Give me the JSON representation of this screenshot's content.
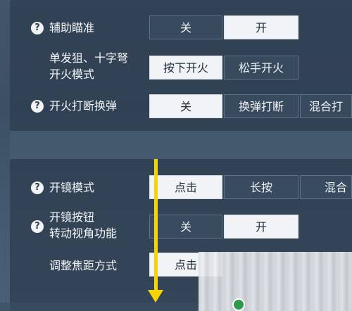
{
  "settings_top": [
    {
      "label": "辅助瞄准",
      "has_help": true,
      "options": [
        "关",
        "开"
      ],
      "selected": "开"
    },
    {
      "label_line1": "单发狙、十字弩",
      "label_line2": "开火模式",
      "has_help": false,
      "options": [
        "按下开火",
        "松手开火"
      ],
      "selected": "按下开火"
    },
    {
      "label": "开火打断换弹",
      "has_help": true,
      "options": [
        "关",
        "换弹打断",
        "混合打"
      ],
      "selected": "关"
    }
  ],
  "settings_bottom": [
    {
      "label": "开镜模式",
      "has_help": true,
      "options": [
        "点击",
        "长按",
        "混合"
      ],
      "selected": "点击"
    },
    {
      "label_line1": "开镜按钮",
      "label_line2": "转动视角功能",
      "has_help": true,
      "options": [
        "关",
        "开"
      ],
      "selected": "开"
    },
    {
      "label": "调整焦距方式",
      "has_help": false,
      "options": [
        "点击"
      ],
      "selected": "点击"
    }
  ],
  "help_glyph": "?",
  "annotation_color": "#f5d400",
  "icons": {
    "help": "help-circle-icon",
    "annotation": "arrow-down-icon"
  }
}
